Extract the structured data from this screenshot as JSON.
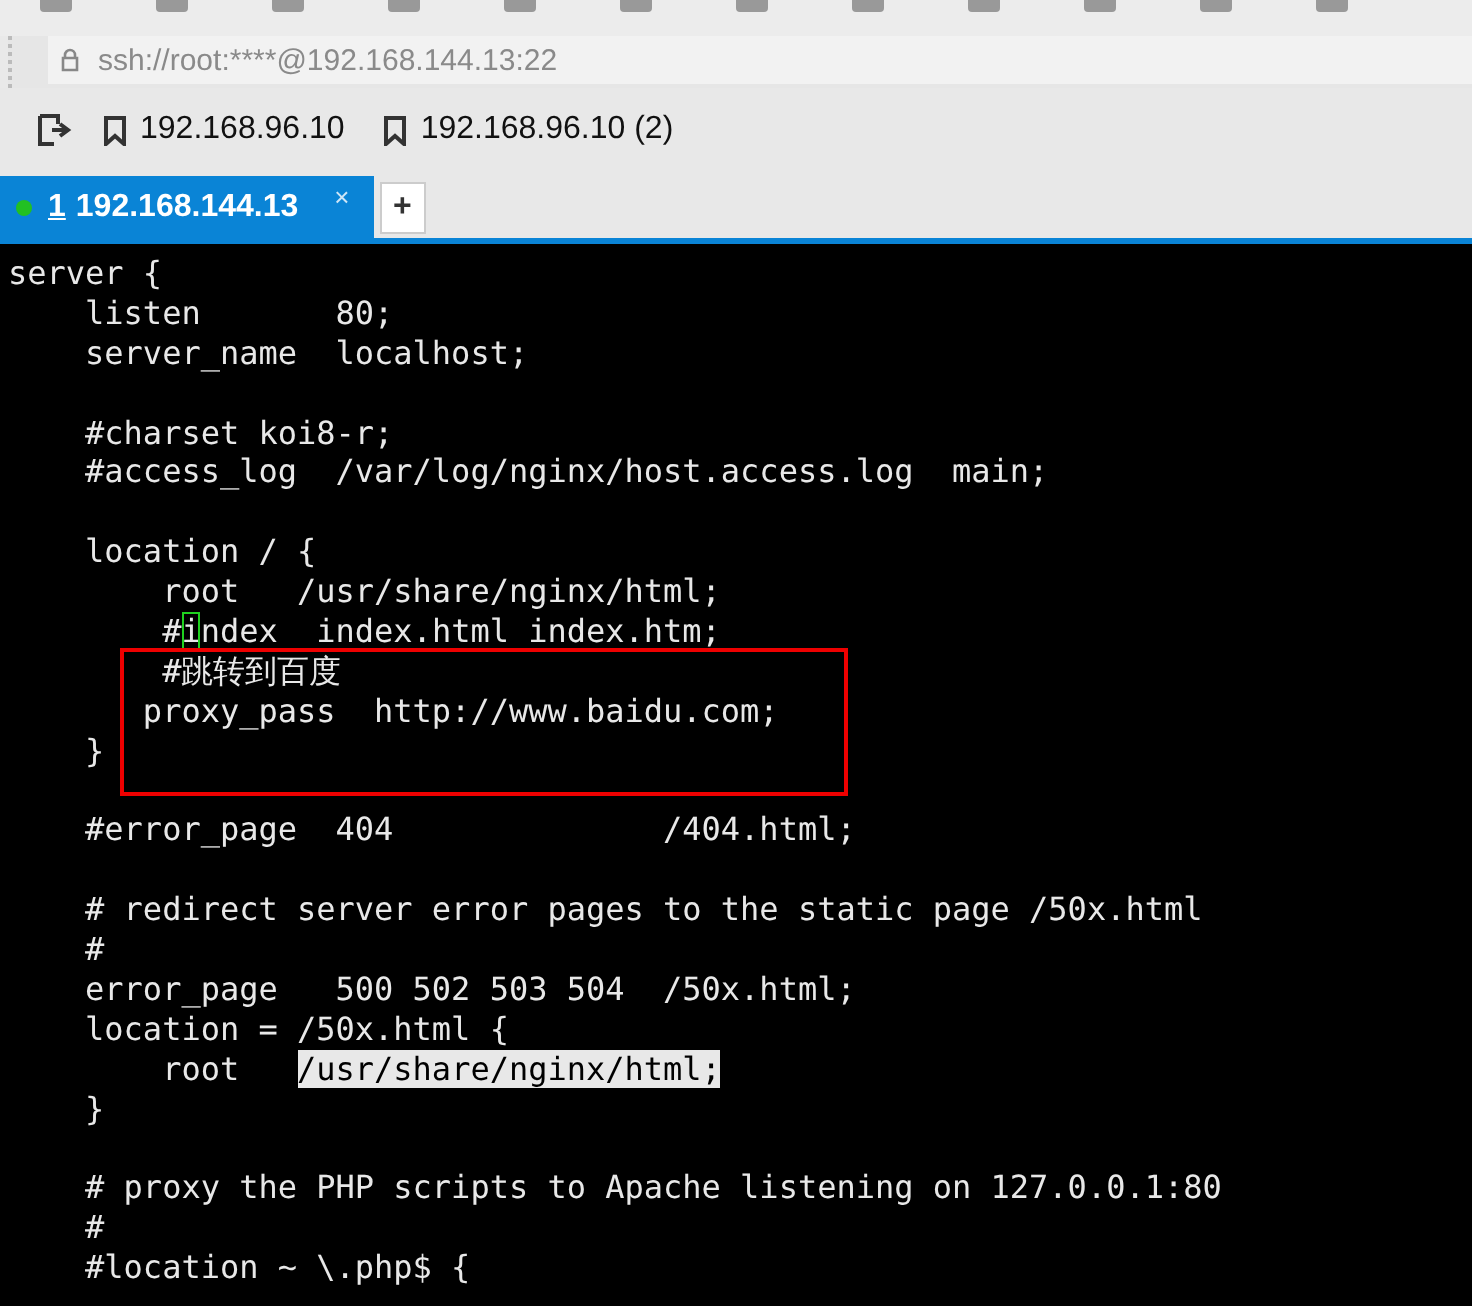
{
  "address_bar": {
    "value": "ssh://root:****@192.168.144.13:22"
  },
  "bookmarks": [
    {
      "label": "192.168.96.10"
    },
    {
      "label": "192.168.96.10 (2)"
    }
  ],
  "tabs": [
    {
      "number": "1",
      "label": "192.168.144.13",
      "selected": true,
      "connected": true,
      "close": "×"
    }
  ],
  "new_tab": "+",
  "terminal": {
    "lines": [
      {
        "kind": "text",
        "text": "server {"
      },
      {
        "kind": "text",
        "text": "    listen       80;"
      },
      {
        "kind": "text",
        "text": "    server_name  localhost;"
      },
      {
        "kind": "blank"
      },
      {
        "kind": "text",
        "text": "    #charset koi8-r;"
      },
      {
        "kind": "text",
        "text": "    #access_log  /var/log/nginx/host.access.log  main;"
      },
      {
        "kind": "blank"
      },
      {
        "kind": "text",
        "text": "    location / {"
      },
      {
        "kind": "text",
        "text": "        root   /usr/share/nginx/html;"
      },
      {
        "kind": "mixed",
        "segments": [
          {
            "kind": "plain",
            "text": "        #"
          },
          {
            "kind": "cursor",
            "text": "i"
          },
          {
            "kind": "plain",
            "text": "ndex  index.html index.htm;"
          }
        ]
      },
      {
        "kind": "text",
        "text": "        #跳转到百度"
      },
      {
        "kind": "text",
        "text": "       proxy_pass  http://www.baidu.com;"
      },
      {
        "kind": "text",
        "text": "    }"
      },
      {
        "kind": "blank"
      },
      {
        "kind": "text",
        "text": "    #error_page  404              /404.html;"
      },
      {
        "kind": "blank"
      },
      {
        "kind": "text",
        "text": "    # redirect server error pages to the static page /50x.html"
      },
      {
        "kind": "text",
        "text": "    #"
      },
      {
        "kind": "text",
        "text": "    error_page   500 502 503 504  /50x.html;"
      },
      {
        "kind": "text",
        "text": "    location = /50x.html {"
      },
      {
        "kind": "mixed",
        "segments": [
          {
            "kind": "plain",
            "text": "        root   "
          },
          {
            "kind": "selected",
            "text": "/usr/share/nginx/html;"
          }
        ]
      },
      {
        "kind": "text",
        "text": "    }"
      },
      {
        "kind": "blank"
      },
      {
        "kind": "text",
        "text": "    # proxy the PHP scripts to Apache listening on 127.0.0.1:80"
      },
      {
        "kind": "text",
        "text": "    #"
      },
      {
        "kind": "text",
        "text": "    #location ~ \\.php$ {"
      }
    ]
  }
}
